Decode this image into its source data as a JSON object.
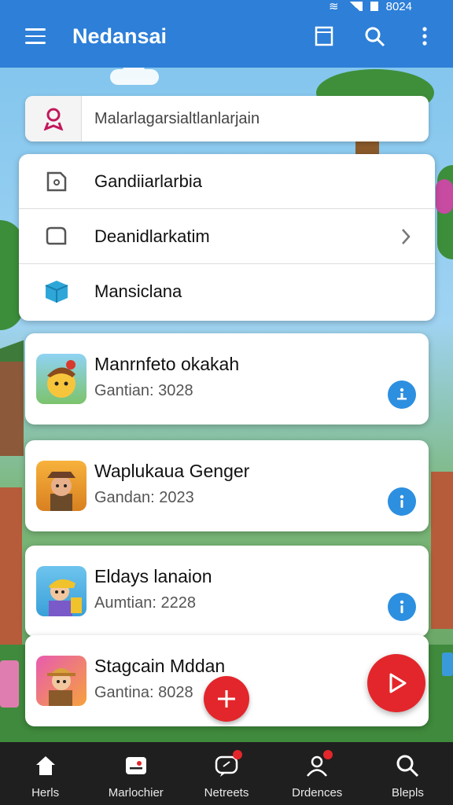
{
  "status_bar": {
    "time": "8024"
  },
  "app_bar": {
    "title": "Nedansai"
  },
  "search": {
    "placeholder": "Malarlagarsialtlanlarjain"
  },
  "menu": {
    "items": [
      {
        "label": "Gandiiarlarbia",
        "icon": "puzzle-icon"
      },
      {
        "label": "Deanidlarkatim",
        "icon": "folder-icon"
      },
      {
        "label": "Mansiclana",
        "icon": "cube-icon"
      }
    ]
  },
  "games": [
    {
      "name": "Manrnfeto okakah",
      "sub": "Gantian: 3028"
    },
    {
      "name": "Waplukaua Genger",
      "sub": "Gandan: 2023"
    },
    {
      "name": "Eldays lanaion",
      "sub": "Aumtian: 2228"
    },
    {
      "name": "Stagcain Mddan",
      "sub": "Gantina: 8028"
    }
  ],
  "bottom_nav": [
    {
      "label": "Herls",
      "icon": "home-icon"
    },
    {
      "label": "Marlochier",
      "icon": "gamepad-icon"
    },
    {
      "label": "Netreets",
      "icon": "chat-icon"
    },
    {
      "label": "Drdences",
      "icon": "people-icon"
    },
    {
      "label": "Blepls",
      "icon": "search-icon"
    }
  ],
  "colors": {
    "primary": "#2d7fd8",
    "accent": "#e3262b",
    "nav_bg": "#1f1f1f"
  }
}
